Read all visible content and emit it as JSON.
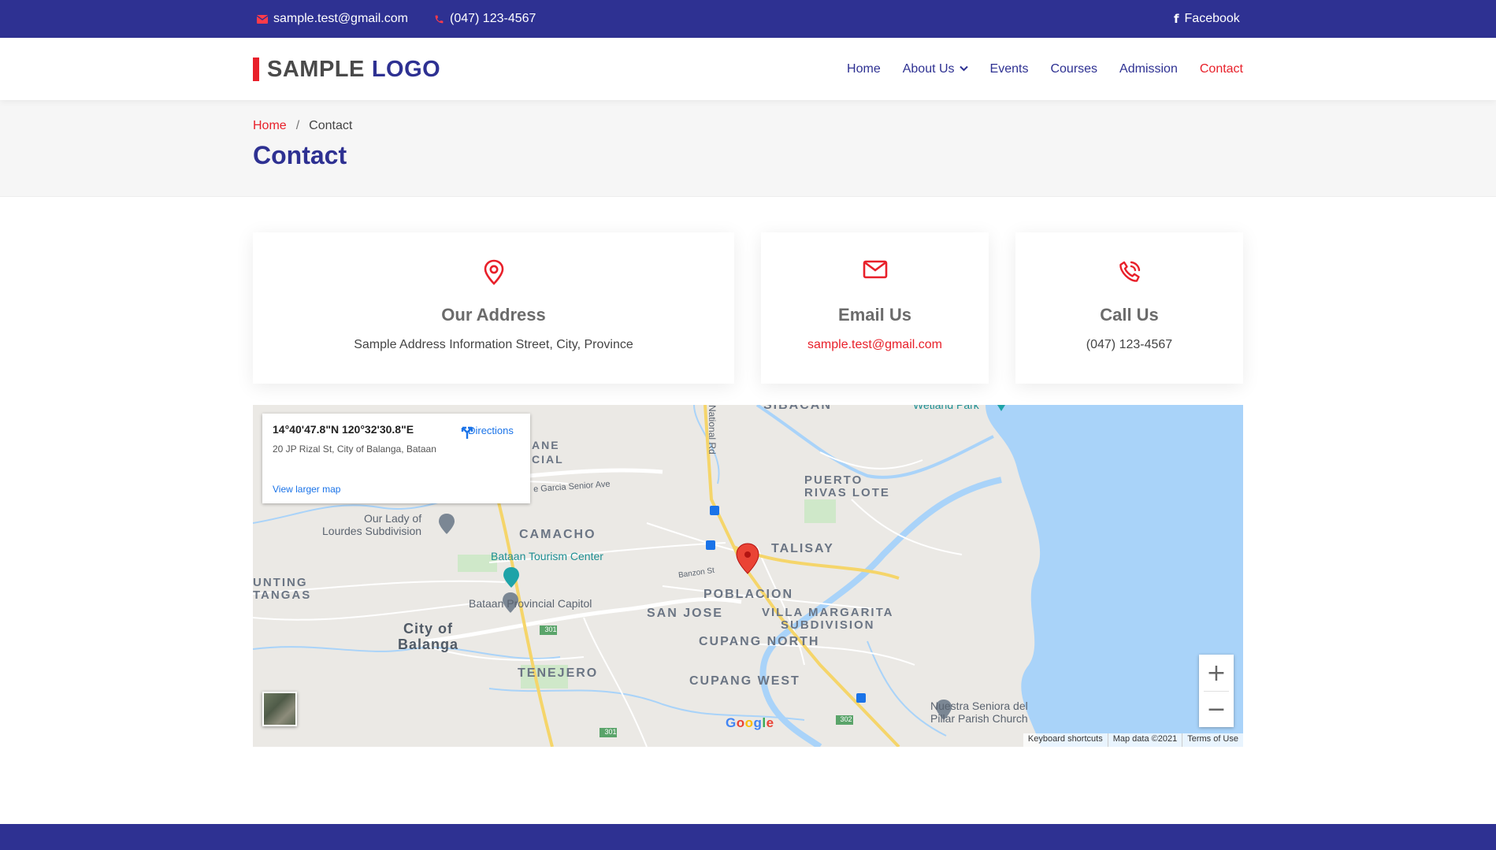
{
  "topbar": {
    "email": "sample.test@gmail.com",
    "phone": "(047) 123-4567",
    "facebook": "Facebook"
  },
  "header": {
    "logo_word1": "SAMPLE",
    "logo_word2": "LOGO",
    "nav": {
      "home": "Home",
      "about": "About Us",
      "events": "Events",
      "courses": "Courses",
      "admission": "Admission",
      "contact": "Contact"
    }
  },
  "breadcrumb": {
    "home": "Home",
    "separator": "/",
    "current": "Contact"
  },
  "page_title": "Contact",
  "cards": {
    "address": {
      "title": "Our Address",
      "text": "Sample Address Information Street, City, Province"
    },
    "email": {
      "title": "Email Us",
      "text": "sample.test@gmail.com"
    },
    "call": {
      "title": "Call Us",
      "text": "(047) 123-4567"
    }
  },
  "map": {
    "coordinates": "14°40'47.8\"N 120°32'30.8\"E",
    "address": "20 JP Rizal St, City of Balanga, Bataan",
    "directions": "Directions",
    "view_larger": "View larger map",
    "labels": {
      "sibacan": "SIBACAN",
      "wetland": "Wetland Park",
      "ane_cial": "ANE\nCIAL",
      "national_rd": "National Rd",
      "garcia": "e Garcia Senior Ave",
      "puerto": "PUERTO\nRIVAS LOTE",
      "lourdes": "Our Lady of\nLourdes Subdivision",
      "camacho": "CAMACHO",
      "talisay": "TALISAY",
      "tourism": "Bataan Tourism Center",
      "banzon": "Banzon St",
      "unting": "UNTING\nTANGAS",
      "poblacion": "POBLACION",
      "capitol": "Bataan Provincial Capitol",
      "san_jose": "SAN JOSE",
      "villa": "VILLA MARGARITA\nSUBDIVISION",
      "city": "City of\nBalanga",
      "cupang_north": "CUPANG NORTH",
      "tenejero": "TENEJERO",
      "cupang_west": "CUPANG WEST",
      "church": "Nuestra Seniora del\nPillar Parish Church",
      "route_301": "301",
      "route_302": "302"
    },
    "google": "Google",
    "zoom_in": "+",
    "zoom_out": "−",
    "attribution": {
      "shortcuts": "Keyboard shortcuts",
      "data": "Map data ©2021",
      "terms": "Terms of Use"
    }
  },
  "colors": {
    "primary": "#2e3192",
    "accent": "#e8202a",
    "water": "#a9d3f9"
  }
}
